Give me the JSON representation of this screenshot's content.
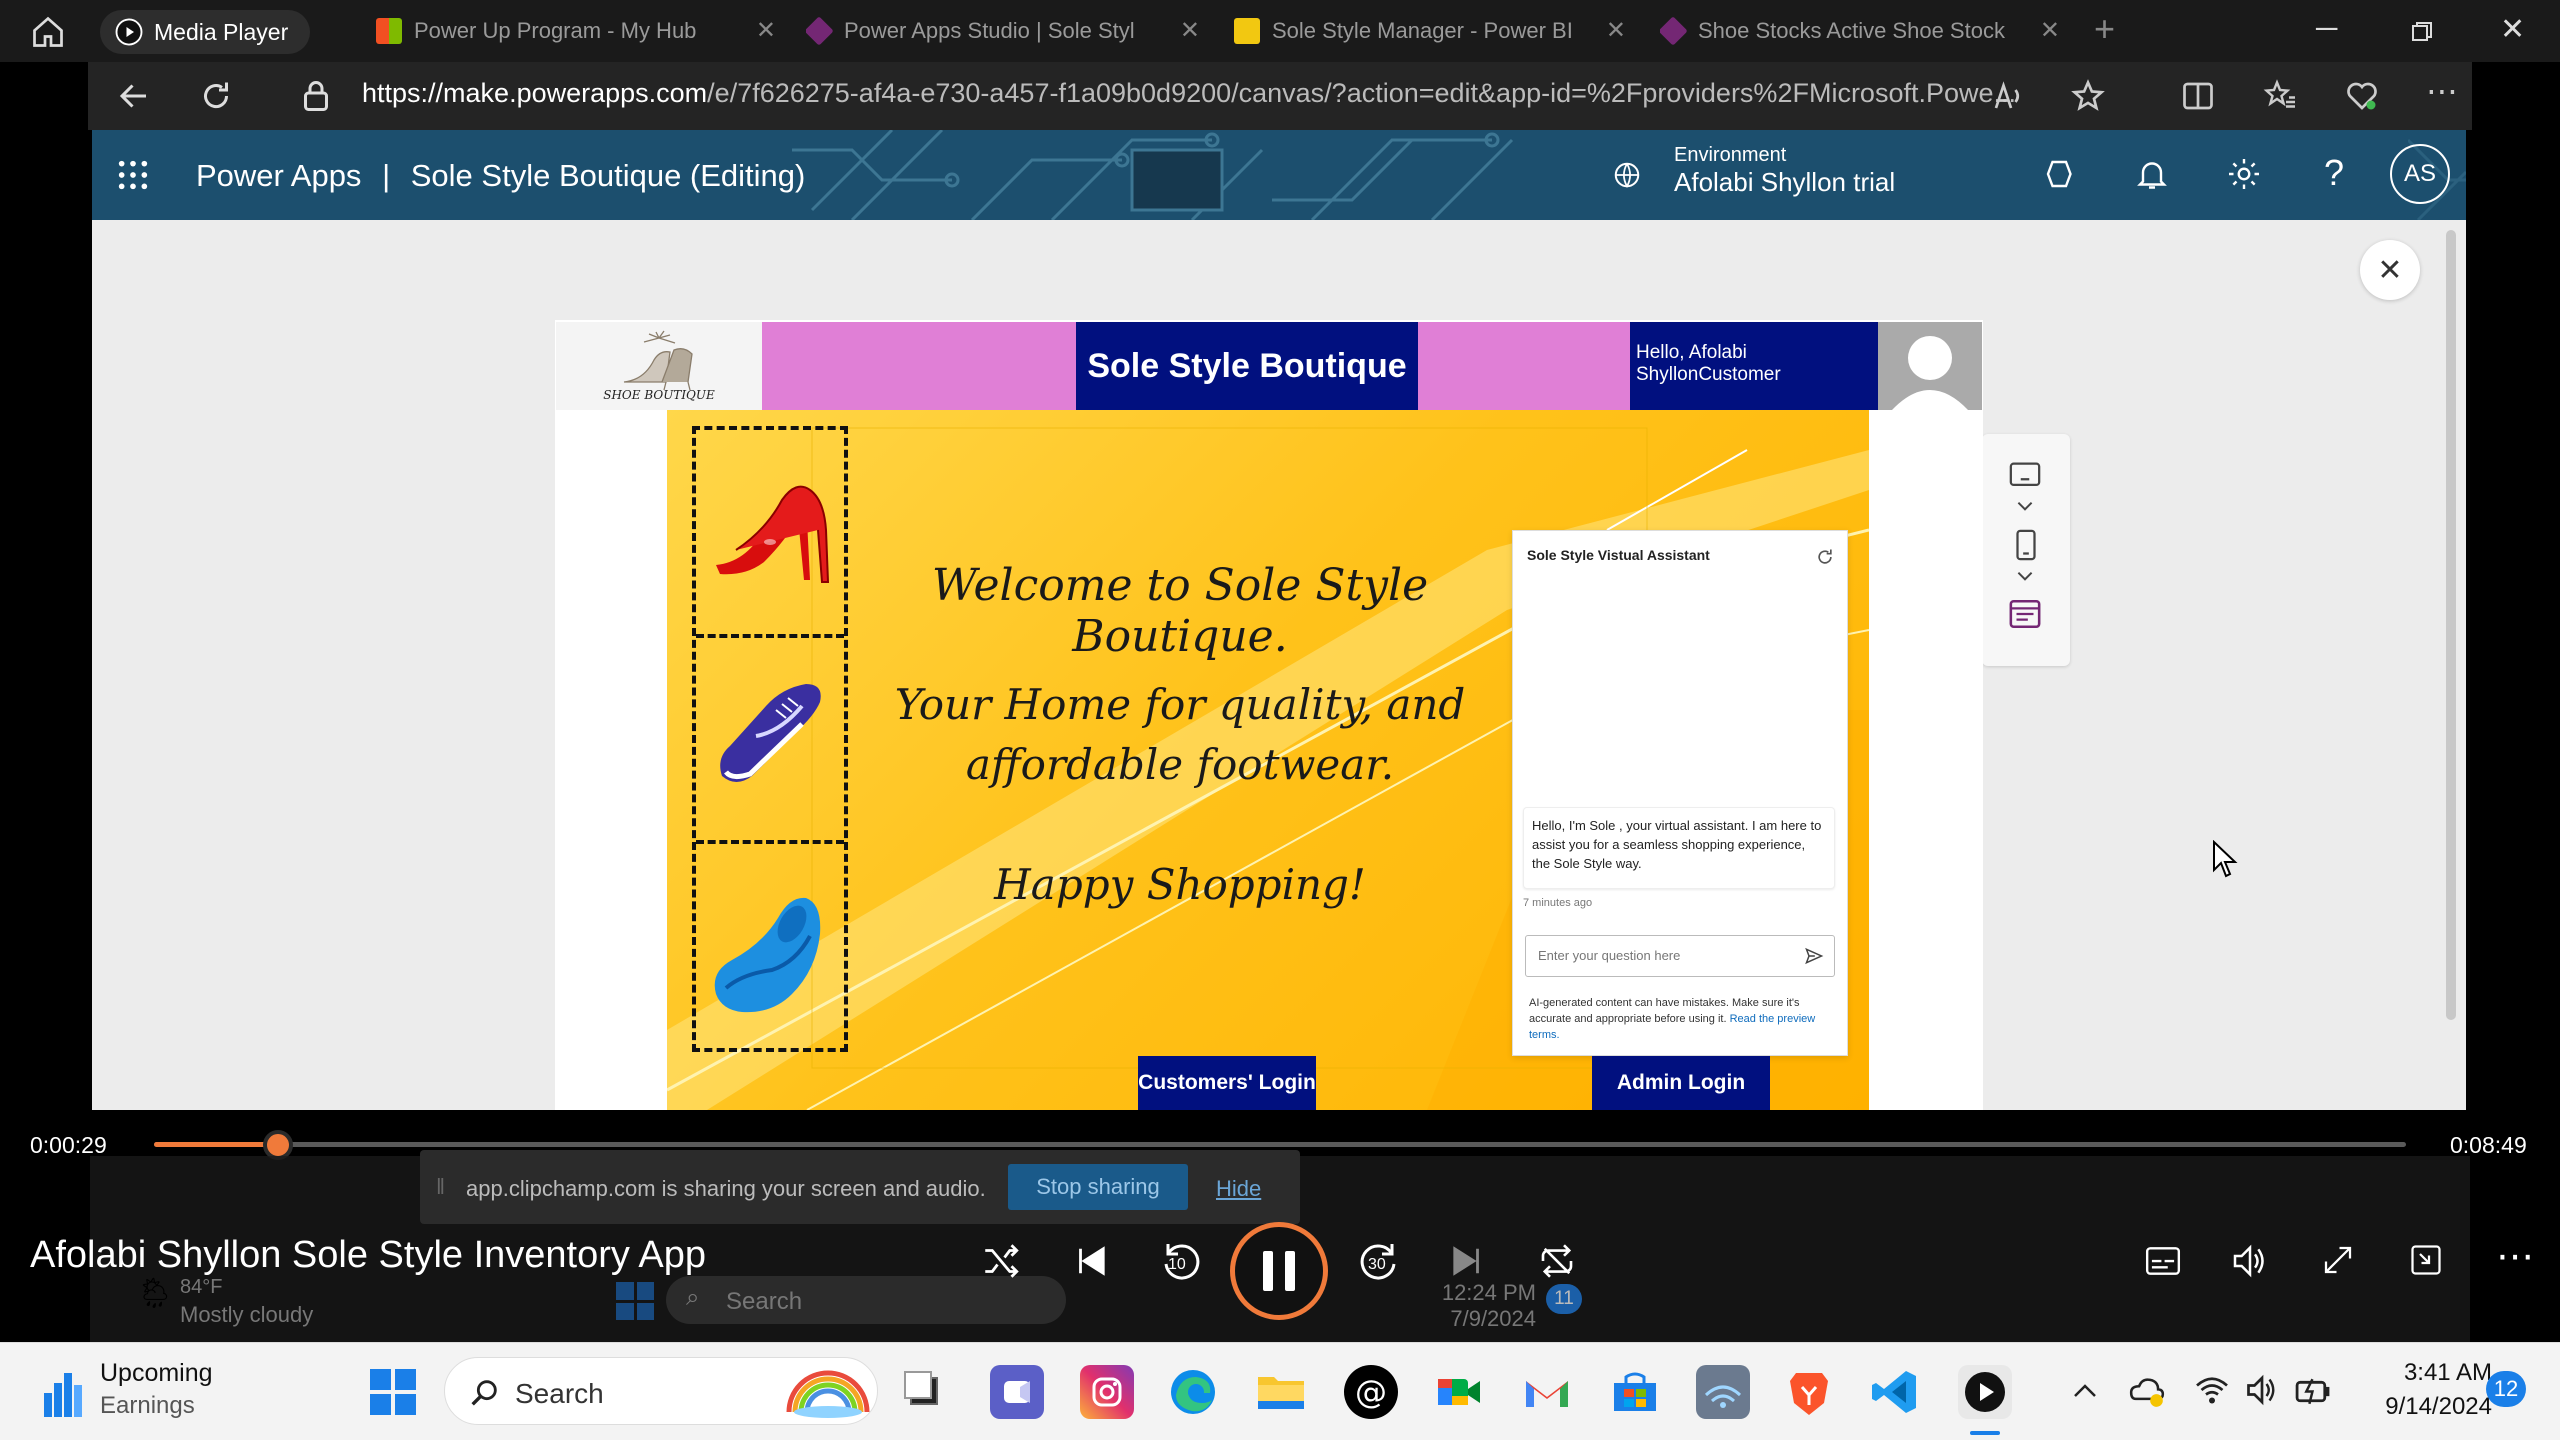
{
  "browser": {
    "tabs": [
      {
        "label": "Media Player"
      },
      {
        "label": "Power Up Program - My Hub"
      },
      {
        "label": "Power Apps Studio | Sole Styl"
      },
      {
        "label": "Sole Style Manager - Power BI"
      },
      {
        "label": "Shoe Stocks Active Shoe Stock"
      }
    ],
    "new_tab": "+",
    "url_host": "https://make.powerapps.com",
    "url_path": "/e/7f626275-af4a-e730-a457-f1a09b0d9200/canvas/?action=edit&app-id=%2Fproviders%2FMicrosoft.Powe..."
  },
  "powerapps": {
    "brand": "Power Apps",
    "separator": "|",
    "app_title": "Sole Style Boutique (Editing)",
    "env_label": "Environment",
    "env_name": "Afolabi Shyllon trial",
    "avatar": "AS"
  },
  "app": {
    "logo_text": "SHOE BOUTIQUE",
    "banner_title": "Sole Style Boutique",
    "greeting": "Hello, Afolabi ShyllonCustomer",
    "welcome": "Welcome to Sole Style Boutique.",
    "tagline_1": "Your Home for quality, and",
    "tagline_2": "affordable footwear.",
    "happy": "Happy Shopping!",
    "customer_login": "Customers' Login",
    "admin_login": "Admin Login"
  },
  "assistant": {
    "title": "Sole Style Vistual Assistant",
    "message": "Hello, I'm Sole , your virtual assistant. I am here to assist you for a seamless shopping experience, the Sole Style way.",
    "timestamp": "7 minutes ago",
    "input_placeholder": "Enter your question here",
    "disclaimer": "AI-generated content can have mistakes. Make sure it's accurate and appropriate before using it.",
    "disclaimer_link": "Read the preview terms."
  },
  "player": {
    "app_name": "Media Player",
    "elapsed": "0:00:29",
    "total": "0:08:49",
    "progress": 0.055,
    "video_title": "Afolabi Shyllon Sole Style Inventory App",
    "skip_back": "10",
    "skip_fwd": "30"
  },
  "sharing": {
    "message": "app.clipchamp.com is sharing your screen and audio.",
    "stop_label": "Stop sharing",
    "hide_label": "Hide"
  },
  "inner_taskbar": {
    "weather_temp": "84°F",
    "weather_desc": "Mostly cloudy",
    "search": "Search",
    "time": "12:24 PM",
    "date": "7/9/2024",
    "badge": "11"
  },
  "taskbar": {
    "widget_title": "Upcoming",
    "widget_sub": "Earnings",
    "search": "Search",
    "time": "3:41 AM",
    "date": "9/14/2024",
    "badge": "12"
  }
}
